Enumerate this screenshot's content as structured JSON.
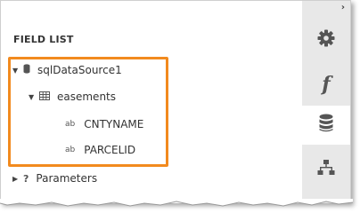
{
  "field_list": {
    "title": "FIELD LIST",
    "datasource": {
      "name": "sqlDataSource1",
      "expanded": true,
      "table": {
        "name": "easements",
        "expanded": true,
        "fields": [
          {
            "type": "ab",
            "name": "CNTYNAME"
          },
          {
            "type": "ab",
            "name": "PARCELID"
          }
        ]
      }
    },
    "parameters": {
      "name": "Parameters",
      "expanded": false
    }
  },
  "sidebar": {
    "collapse_icon": "chevron-right-icon",
    "buttons": [
      {
        "name": "settings",
        "icon": "gear-icon"
      },
      {
        "name": "expressions",
        "icon": "function-icon"
      },
      {
        "name": "field-list",
        "icon": "database-icon",
        "active": true
      },
      {
        "name": "report-explorer",
        "icon": "hierarchy-icon"
      }
    ]
  },
  "colors": {
    "highlight": "#f28a1e",
    "sidebar_bg": "#e8e8e8"
  }
}
